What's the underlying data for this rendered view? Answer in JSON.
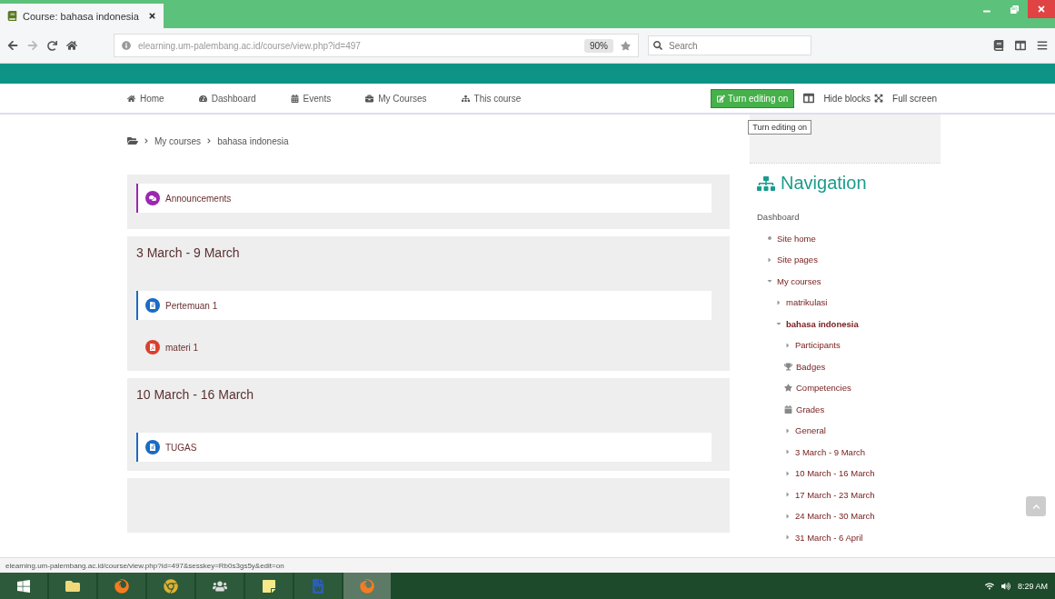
{
  "browser": {
    "tab": {
      "title": "Course: bahasa indonesia",
      "selected": true
    },
    "url": "elearning.um-palembang.ac.id/course/view.php?id=497",
    "zoom": "90%",
    "search": {
      "placeholder": "Search"
    }
  },
  "navbar": {
    "items": [
      {
        "label": "Home"
      },
      {
        "label": "Dashboard"
      },
      {
        "label": "Events"
      },
      {
        "label": "My Courses"
      },
      {
        "label": "This course"
      }
    ],
    "edit_button": "Turn editing on",
    "hide_blocks": "Hide blocks",
    "full_screen": "Full screen",
    "tooltip": "Turn editing on"
  },
  "breadcrumb": [
    "My courses",
    "bahasa indonesia"
  ],
  "sections": [
    {
      "activities": [
        {
          "name": "Announcements",
          "kind": "forum",
          "highlighted": true
        }
      ]
    },
    {
      "title": "3 March - 9 March",
      "activities": [
        {
          "name": "Pertemuan 1",
          "kind": "assign",
          "highlighted": true
        },
        {
          "name": "materi 1",
          "kind": "resource",
          "highlighted": false
        }
      ]
    },
    {
      "title": "10 March - 16 March",
      "activities": [
        {
          "name": "TUGAS",
          "kind": "assign",
          "highlighted": true
        }
      ]
    }
  ],
  "navigation": {
    "title": "Navigation",
    "items": [
      {
        "label": "Dashboard",
        "kind": "root",
        "children": [
          {
            "label": "Site home",
            "kind": "leaf"
          },
          {
            "label": "Site pages",
            "kind": "branch",
            "expanded": false
          },
          {
            "label": "My courses",
            "kind": "branch",
            "expanded": true,
            "children": [
              {
                "label": "matrikulasi",
                "kind": "branch",
                "expanded": false
              },
              {
                "label": "bahasa indonesia",
                "kind": "branch",
                "expanded": true,
                "current": true,
                "children": [
                  {
                    "label": "Participants",
                    "kind": "branch",
                    "expanded": false
                  },
                  {
                    "label": "Badges",
                    "kind": "badges"
                  },
                  {
                    "label": "Competencies",
                    "kind": "competencies"
                  },
                  {
                    "label": "Grades",
                    "kind": "grades"
                  },
                  {
                    "label": "General",
                    "kind": "branch",
                    "expanded": false
                  },
                  {
                    "label": "3 March - 9 March",
                    "kind": "branch",
                    "expanded": false
                  },
                  {
                    "label": "10 March - 16 March",
                    "kind": "branch",
                    "expanded": false
                  },
                  {
                    "label": "17 March - 23 March",
                    "kind": "branch",
                    "expanded": false
                  },
                  {
                    "label": "24 March - 30 March",
                    "kind": "branch",
                    "expanded": false
                  },
                  {
                    "label": "31 March - 6 April",
                    "kind": "branch",
                    "expanded": false
                  }
                ]
              }
            ]
          }
        ]
      }
    ]
  },
  "status_url": "elearning.um-palembang.ac.id/course/view.php?id=497&sesskey=Rb0s3gs5y&edit=on",
  "taskbar": {
    "apps": [
      {
        "kind": "folder",
        "selected": false
      },
      {
        "kind": "firefox",
        "selected": false
      },
      {
        "kind": "chrome",
        "selected": false
      },
      {
        "kind": "people",
        "selected": false
      },
      {
        "kind": "notes",
        "selected": false
      },
      {
        "kind": "word",
        "selected": false
      },
      {
        "kind": "firefox",
        "selected": true
      }
    ],
    "time": "8:29 AM"
  }
}
